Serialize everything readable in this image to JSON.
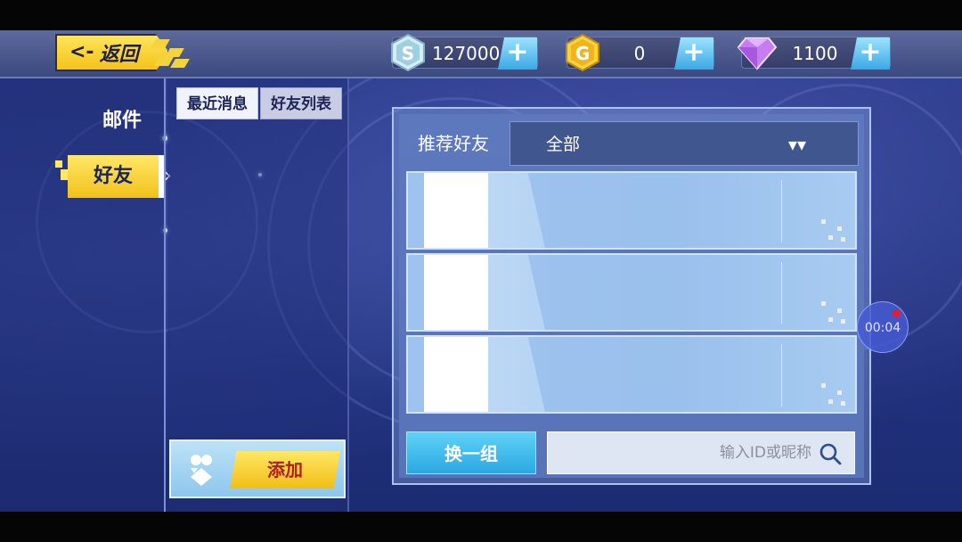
{
  "topbar": {
    "back_label": "返回",
    "currencies": [
      {
        "name": "silver-coin",
        "icon": "silver-s-coin-icon",
        "letter": "S",
        "value": "127000"
      },
      {
        "name": "gold-coin",
        "icon": "gold-g-coin-icon",
        "letter": "G",
        "value": "0"
      },
      {
        "name": "diamond",
        "icon": "purple-diamond-icon",
        "value": "1100"
      }
    ],
    "plus_symbol": "+"
  },
  "sidebar": {
    "items": [
      {
        "label": "邮件",
        "active": false
      },
      {
        "label": "好友",
        "active": true
      }
    ]
  },
  "subtabs": {
    "recent": "最近消息",
    "friend_list": "好友列表"
  },
  "add_panel": {
    "button_label": "添加"
  },
  "recommend": {
    "title": "推荐好友",
    "filter_value": "全部",
    "filter_icon": "double-chevron-down-icon",
    "refresh_label": "换一组",
    "search_placeholder": "输入ID或昵称",
    "rows": [
      {
        "avatar": ""
      },
      {
        "avatar": ""
      },
      {
        "avatar": ""
      }
    ]
  },
  "overlay": {
    "timer": "00:04"
  },
  "colors": {
    "accent_yellow": "#f4c21a",
    "accent_blue": "#3aa8e4",
    "panel_blue": "#5873b8"
  }
}
